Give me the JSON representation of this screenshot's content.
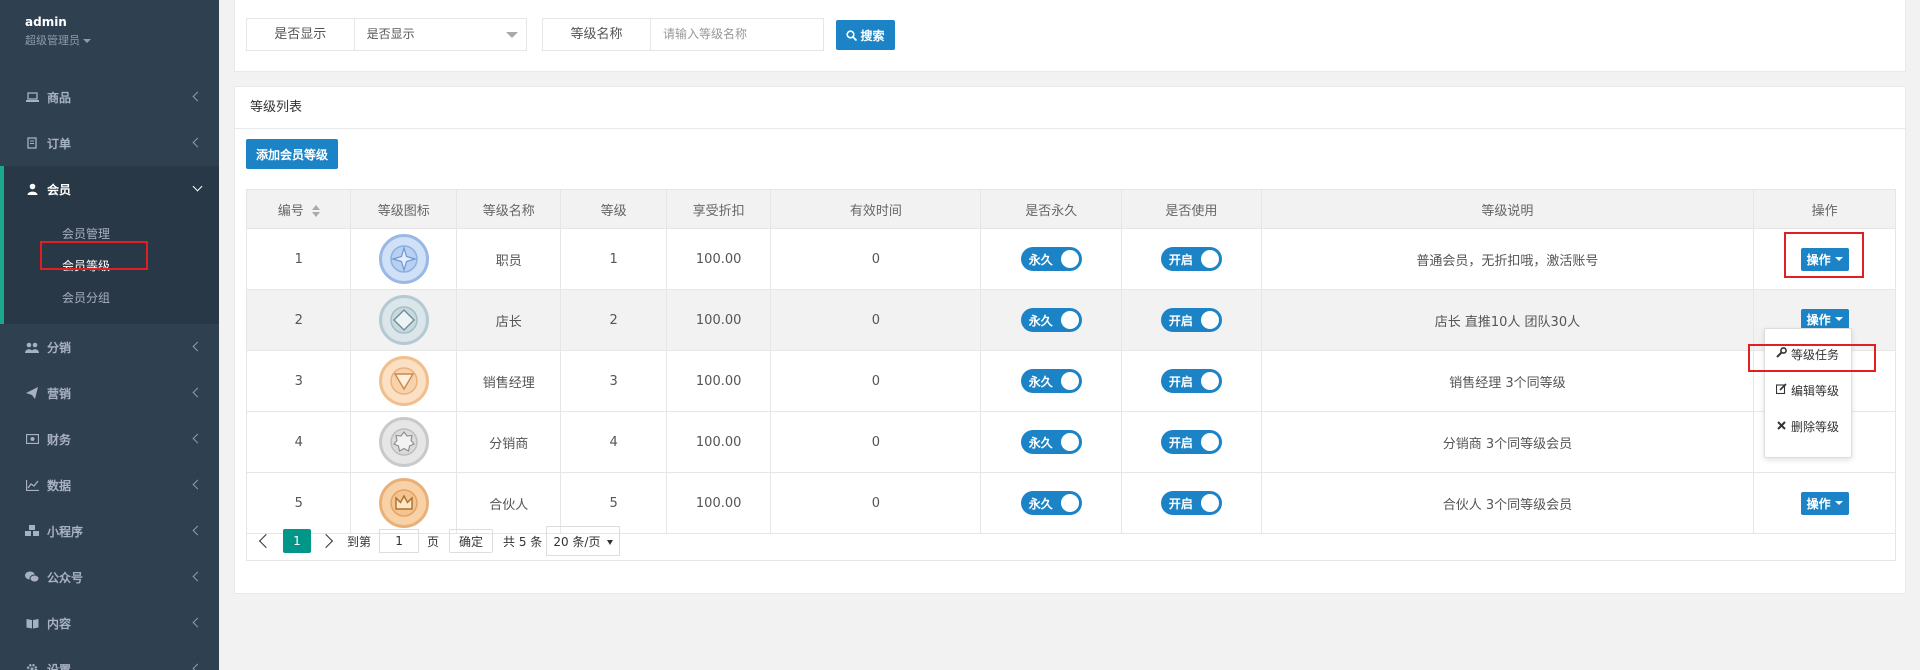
{
  "user": {
    "name": "admin",
    "role": "超级管理员"
  },
  "sidebar": {
    "items": [
      {
        "label": "商品",
        "icon": "laptop-icon"
      },
      {
        "label": "订单",
        "icon": "document-icon"
      },
      {
        "label": "会员",
        "icon": "user-icon"
      },
      {
        "label": "分销",
        "icon": "users-icon"
      },
      {
        "label": "营销",
        "icon": "paper-plane-icon"
      },
      {
        "label": "财务",
        "icon": "money-icon"
      },
      {
        "label": "数据",
        "icon": "line-chart-icon"
      },
      {
        "label": "小程序",
        "icon": "cubes-icon"
      },
      {
        "label": "公众号",
        "icon": "wechat-icon"
      },
      {
        "label": "内容",
        "icon": "book-icon"
      },
      {
        "label": "设置",
        "icon": "gear-icon"
      }
    ],
    "submenu": [
      "会员管理",
      "会员等级",
      "会员分组"
    ]
  },
  "filters": {
    "show_label": "是否显示",
    "show_value": "是否显示",
    "name_label": "等级名称",
    "name_placeholder": "请输入等级名称",
    "search_label": "搜索"
  },
  "panel": {
    "title": "等级列表",
    "add_label": "添加会员等级"
  },
  "table": {
    "headers": [
      "编号",
      "等级图标",
      "等级名称",
      "等级",
      "享受折扣",
      "有效时间",
      "是否永久",
      "是否使用",
      "等级说明",
      "操作"
    ],
    "rows": [
      {
        "id": "1",
        "name": "职员",
        "level": "1",
        "discount": "100.00",
        "time": "0",
        "permanent": "永久",
        "enabled": "开启",
        "desc": "普通会员，无折扣哦，激活账号",
        "op": "操作",
        "badge": "star"
      },
      {
        "id": "2",
        "name": "店长",
        "level": "2",
        "discount": "100.00",
        "time": "0",
        "permanent": "永久",
        "enabled": "开启",
        "desc": "店长 直推10人 团队30人",
        "op": "操作",
        "badge": "diamond"
      },
      {
        "id": "3",
        "name": "销售经理",
        "level": "3",
        "discount": "100.00",
        "time": "0",
        "permanent": "永久",
        "enabled": "开启",
        "desc": "销售经理 3个同等级",
        "op": "操作",
        "badge": "triangle"
      },
      {
        "id": "4",
        "name": "分销商",
        "level": "4",
        "discount": "100.00",
        "time": "0",
        "permanent": "永久",
        "enabled": "开启",
        "desc": "分销商 3个同等级会员",
        "op": "操作",
        "badge": "octagon"
      },
      {
        "id": "5",
        "name": "合伙人",
        "level": "5",
        "discount": "100.00",
        "time": "0",
        "permanent": "永久",
        "enabled": "开启",
        "desc": "合伙人 3个同等级会员",
        "op": "操作",
        "badge": "crown"
      }
    ]
  },
  "dropdown": {
    "items": [
      "等级任务",
      "编辑等级",
      "删除等级"
    ]
  },
  "pager": {
    "current": "1",
    "goto": "到第",
    "page_input": "1",
    "page_unit": "页",
    "confirm": "确定",
    "total": "共 5 条",
    "size": "20 条/页"
  },
  "colors": {
    "primary": "#1c84c6",
    "sidebar": "#2f4050",
    "pager_active": "#009688",
    "highlight": "#e02020"
  }
}
